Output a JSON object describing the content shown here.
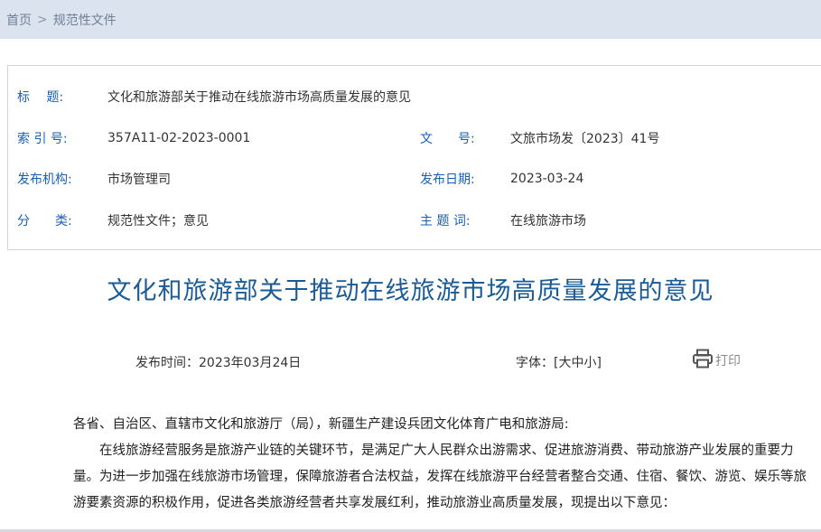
{
  "breadcrumb": {
    "home": "首页",
    "separator": ">",
    "current": "规范性文件"
  },
  "meta": {
    "title_label": "标　 题:",
    "title_value": "文化和旅游部关于推动在线旅游市场高质量发展的意见",
    "index_label": "索 引 号:",
    "index_value": "357A11-02-2023-0001",
    "docno_label": "文　　号:",
    "docno_value": "文旅市场发〔2023〕41号",
    "org_label": "发布机构:",
    "org_value": "市场管理司",
    "date_label": "发布日期:",
    "date_value": "2023-03-24",
    "category_label": "分　　类:",
    "category_value": "规范性文件；意见",
    "topic_label": "主 题 词:",
    "topic_value": "在线旅游市场"
  },
  "document": {
    "title": "文化和旅游部关于推动在线旅游市场高质量发展的意见",
    "publish_time": "发布时间：2023年03月24日",
    "font_size_control": "字体：[大中小]",
    "print_label": "打印",
    "salutation": "各省、自治区、直辖市文化和旅游厅（局），新疆生产建设兵团文化体育广电和旅游局:",
    "paragraph1": "在线旅游经营服务是旅游产业链的关键环节，是满足广大人民群众出游需求、促进旅游消费、带动旅游产业发展的重要力量。为进一步加强在线旅游市场管理，保障旅游者合法权益，发挥在线旅游平台经营者整合交通、住宿、餐饮、游览、娱乐等旅游要素资源的积极作用，促进各类旅游经营者共享发展红利，推动旅游业高质量发展，现提出以下意见："
  }
}
